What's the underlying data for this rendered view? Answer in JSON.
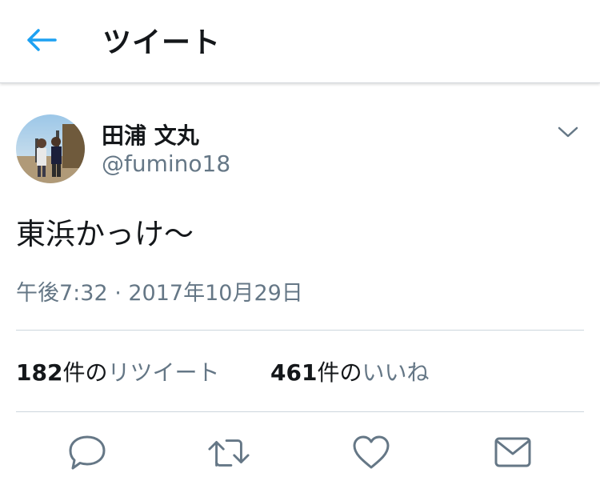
{
  "header": {
    "title": "ツイート",
    "back_icon": "back-arrow-icon"
  },
  "tweet": {
    "author_name": "田浦 文丸",
    "author_handle": "@fumino18",
    "text": "東浜かっけ〜",
    "timestamp": "午後7:32 · 2017年10月29日"
  },
  "stats": {
    "retweets": {
      "count": "182",
      "unit": "件の",
      "label": "リツイート"
    },
    "likes": {
      "count": "461",
      "unit": "件の",
      "label": "いいね"
    }
  },
  "actions": [
    "reply-icon",
    "retweet-icon",
    "like-icon",
    "share-dm-icon"
  ],
  "colors": {
    "accent": "#1da1f2",
    "text": "#14171a",
    "secondary": "#657786",
    "divider": "#ccd6dd"
  }
}
